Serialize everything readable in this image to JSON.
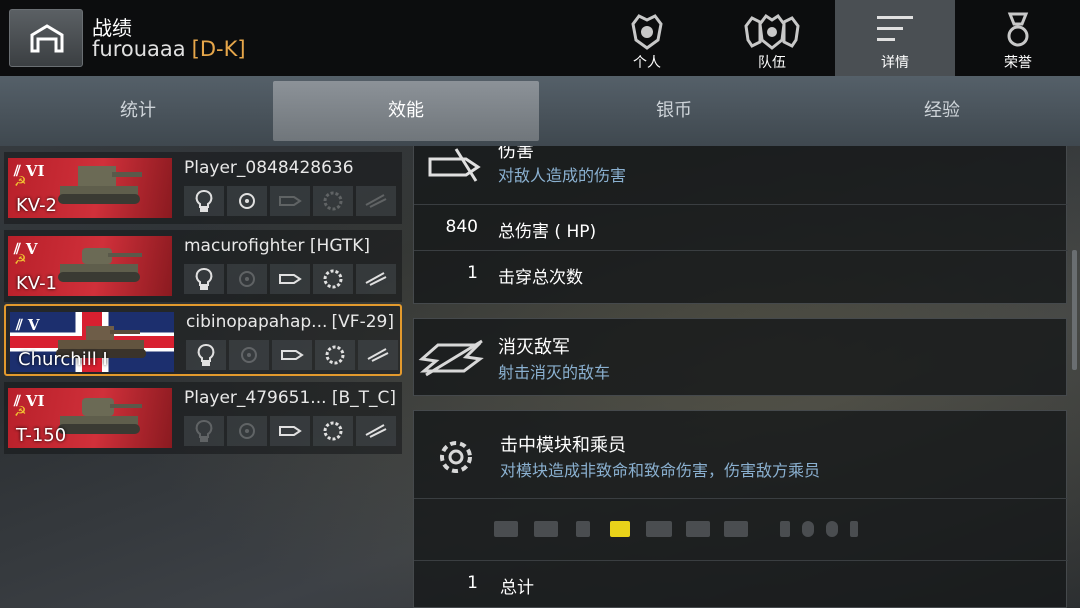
{
  "header": {
    "title": "战绩",
    "player_name": "furouaaa",
    "player_clan": "[D-K]"
  },
  "nav_tabs": [
    {
      "label": "个人",
      "icon": "personal-icon"
    },
    {
      "label": "队伍",
      "icon": "team-icon"
    },
    {
      "label": "详情",
      "icon": "details-icon",
      "active": true
    },
    {
      "label": "荣誉",
      "icon": "medal-icon"
    }
  ],
  "sub_tabs": [
    {
      "label": "统计"
    },
    {
      "label": "效能",
      "active": true
    },
    {
      "label": "银币"
    },
    {
      "label": "经验"
    }
  ],
  "players": [
    {
      "tank": "KV-2",
      "tier": "VI",
      "nation": "ussr",
      "name": "Player_0848428636",
      "clan": "",
      "achieved": [
        true,
        true,
        false,
        false,
        false
      ]
    },
    {
      "tank": "KV-1",
      "tier": "V",
      "nation": "ussr",
      "name": "macurofighter [HGTK]",
      "clan": "",
      "achieved": [
        true,
        false,
        true,
        true,
        true
      ]
    },
    {
      "tank": "Churchill I",
      "tier": "V",
      "nation": "uk",
      "name": "cibinopapahap...",
      "clan": "[VF-29]",
      "selected": true,
      "achieved": [
        true,
        false,
        true,
        true,
        true
      ]
    },
    {
      "tank": "T-150",
      "tier": "VI",
      "nation": "ussr",
      "name": "Player_479651...",
      "clan": "[B_T_C]",
      "achieved": [
        false,
        false,
        true,
        true,
        true
      ]
    }
  ],
  "damage_card": {
    "title": "伤害",
    "subtitle": "对敌人造成的伤害",
    "rows": [
      {
        "value": "840",
        "label": "总伤害 ( HP)"
      },
      {
        "value": "1",
        "label": "击穿总次数"
      }
    ]
  },
  "kills_card": {
    "title": "消灭敌军",
    "subtitle": "射击消灭的敌车"
  },
  "modules_card": {
    "title": "击中模块和乘员",
    "subtitle": "对模块造成非致命和致命伤害，伤害敌方乘员",
    "module_icons": [
      "engine-icon",
      "ammo-rack-icon",
      "fuel-tank-icon",
      "radio-icon",
      "gun-icon",
      "turret-icon",
      "tracks-icon",
      "commander-icon",
      "gunner-icon",
      "driver-icon",
      "loader-icon"
    ],
    "highlighted_module": "radio-icon",
    "total_value": "1",
    "total_label": "总计"
  },
  "colors": {
    "accent": "#e39a2d",
    "clan": "#e6a64a",
    "subtitle": "#8ab0d0",
    "highlight": "#e8d21a"
  }
}
